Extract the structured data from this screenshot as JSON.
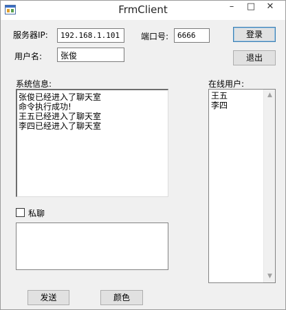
{
  "window": {
    "title": "FrmClient"
  },
  "form": {
    "server_ip_label": "服务器IP:",
    "server_ip_value": "192.168.1.101",
    "port_label": "端口号:",
    "port_value": "6666",
    "username_label": "用户名:",
    "username_value": "张俊",
    "login_button": "登录",
    "logout_button": "退出"
  },
  "system_info": {
    "label": "系统信息:",
    "lines": [
      "张俊已经进入了聊天室",
      "命令执行成功!",
      "王五已经进入了聊天室",
      "李四已经进入了聊天室"
    ]
  },
  "online_users": {
    "label": "在线用户:",
    "users": [
      "王五",
      "李四"
    ]
  },
  "private_chat": {
    "label": "私聊",
    "checked": false
  },
  "message_input": {
    "value": ""
  },
  "actions": {
    "send_button": "发送",
    "color_button": "颜色"
  },
  "icons": {
    "app": "window-icon",
    "minimize": "minimize-icon",
    "maximize": "maximize-icon",
    "close": "close-icon"
  }
}
